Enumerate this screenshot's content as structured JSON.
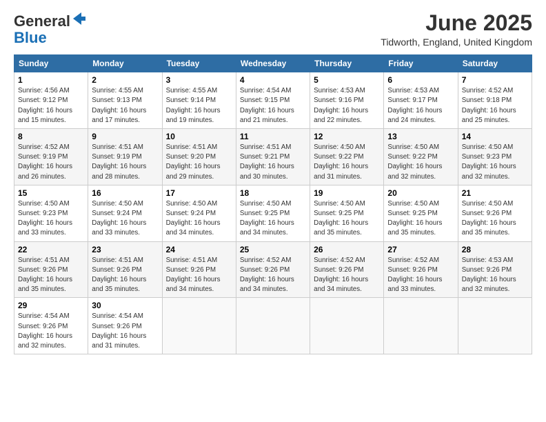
{
  "logo": {
    "general": "General",
    "blue": "Blue"
  },
  "title": "June 2025",
  "location": "Tidworth, England, United Kingdom",
  "days_header": [
    "Sunday",
    "Monday",
    "Tuesday",
    "Wednesday",
    "Thursday",
    "Friday",
    "Saturday"
  ],
  "weeks": [
    [
      {
        "day": "1",
        "sunrise": "4:56 AM",
        "sunset": "9:12 PM",
        "daylight": "16 hours and 15 minutes."
      },
      {
        "day": "2",
        "sunrise": "4:55 AM",
        "sunset": "9:13 PM",
        "daylight": "16 hours and 17 minutes."
      },
      {
        "day": "3",
        "sunrise": "4:55 AM",
        "sunset": "9:14 PM",
        "daylight": "16 hours and 19 minutes."
      },
      {
        "day": "4",
        "sunrise": "4:54 AM",
        "sunset": "9:15 PM",
        "daylight": "16 hours and 21 minutes."
      },
      {
        "day": "5",
        "sunrise": "4:53 AM",
        "sunset": "9:16 PM",
        "daylight": "16 hours and 22 minutes."
      },
      {
        "day": "6",
        "sunrise": "4:53 AM",
        "sunset": "9:17 PM",
        "daylight": "16 hours and 24 minutes."
      },
      {
        "day": "7",
        "sunrise": "4:52 AM",
        "sunset": "9:18 PM",
        "daylight": "16 hours and 25 minutes."
      }
    ],
    [
      {
        "day": "8",
        "sunrise": "4:52 AM",
        "sunset": "9:19 PM",
        "daylight": "16 hours and 26 minutes."
      },
      {
        "day": "9",
        "sunrise": "4:51 AM",
        "sunset": "9:19 PM",
        "daylight": "16 hours and 28 minutes."
      },
      {
        "day": "10",
        "sunrise": "4:51 AM",
        "sunset": "9:20 PM",
        "daylight": "16 hours and 29 minutes."
      },
      {
        "day": "11",
        "sunrise": "4:51 AM",
        "sunset": "9:21 PM",
        "daylight": "16 hours and 30 minutes."
      },
      {
        "day": "12",
        "sunrise": "4:50 AM",
        "sunset": "9:22 PM",
        "daylight": "16 hours and 31 minutes."
      },
      {
        "day": "13",
        "sunrise": "4:50 AM",
        "sunset": "9:22 PM",
        "daylight": "16 hours and 32 minutes."
      },
      {
        "day": "14",
        "sunrise": "4:50 AM",
        "sunset": "9:23 PM",
        "daylight": "16 hours and 32 minutes."
      }
    ],
    [
      {
        "day": "15",
        "sunrise": "4:50 AM",
        "sunset": "9:23 PM",
        "daylight": "16 hours and 33 minutes."
      },
      {
        "day": "16",
        "sunrise": "4:50 AM",
        "sunset": "9:24 PM",
        "daylight": "16 hours and 33 minutes."
      },
      {
        "day": "17",
        "sunrise": "4:50 AM",
        "sunset": "9:24 PM",
        "daylight": "16 hours and 34 minutes."
      },
      {
        "day": "18",
        "sunrise": "4:50 AM",
        "sunset": "9:25 PM",
        "daylight": "16 hours and 34 minutes."
      },
      {
        "day": "19",
        "sunrise": "4:50 AM",
        "sunset": "9:25 PM",
        "daylight": "16 hours and 35 minutes."
      },
      {
        "day": "20",
        "sunrise": "4:50 AM",
        "sunset": "9:25 PM",
        "daylight": "16 hours and 35 minutes."
      },
      {
        "day": "21",
        "sunrise": "4:50 AM",
        "sunset": "9:26 PM",
        "daylight": "16 hours and 35 minutes."
      }
    ],
    [
      {
        "day": "22",
        "sunrise": "4:51 AM",
        "sunset": "9:26 PM",
        "daylight": "16 hours and 35 minutes."
      },
      {
        "day": "23",
        "sunrise": "4:51 AM",
        "sunset": "9:26 PM",
        "daylight": "16 hours and 35 minutes."
      },
      {
        "day": "24",
        "sunrise": "4:51 AM",
        "sunset": "9:26 PM",
        "daylight": "16 hours and 34 minutes."
      },
      {
        "day": "25",
        "sunrise": "4:52 AM",
        "sunset": "9:26 PM",
        "daylight": "16 hours and 34 minutes."
      },
      {
        "day": "26",
        "sunrise": "4:52 AM",
        "sunset": "9:26 PM",
        "daylight": "16 hours and 34 minutes."
      },
      {
        "day": "27",
        "sunrise": "4:52 AM",
        "sunset": "9:26 PM",
        "daylight": "16 hours and 33 minutes."
      },
      {
        "day": "28",
        "sunrise": "4:53 AM",
        "sunset": "9:26 PM",
        "daylight": "16 hours and 32 minutes."
      }
    ],
    [
      {
        "day": "29",
        "sunrise": "4:54 AM",
        "sunset": "9:26 PM",
        "daylight": "16 hours and 32 minutes."
      },
      {
        "day": "30",
        "sunrise": "4:54 AM",
        "sunset": "9:26 PM",
        "daylight": "16 hours and 31 minutes."
      },
      null,
      null,
      null,
      null,
      null
    ]
  ],
  "labels": {
    "sunrise": "Sunrise:",
    "sunset": "Sunset:",
    "daylight": "Daylight:"
  }
}
